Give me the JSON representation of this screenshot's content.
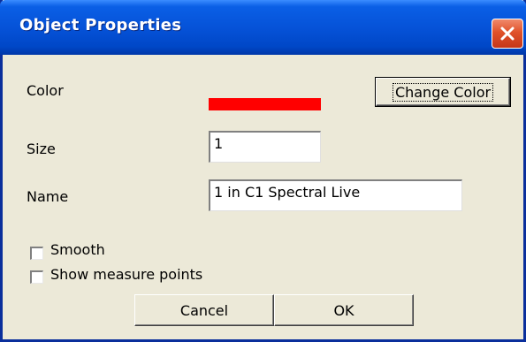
{
  "window": {
    "title": "Object Properties"
  },
  "color": {
    "label": "Color",
    "value": "#ff0000",
    "change_button": "Change Color"
  },
  "size": {
    "label": "Size",
    "value": "1"
  },
  "name": {
    "label": "Name",
    "value": "1 in C1 Spectral Live"
  },
  "options": {
    "smooth": {
      "label": "Smooth",
      "checked": false
    },
    "show_measure_points": {
      "label": "Show measure points",
      "checked": false
    }
  },
  "buttons": {
    "cancel": "Cancel",
    "ok": "OK"
  },
  "icons": {
    "close": "close-icon"
  }
}
